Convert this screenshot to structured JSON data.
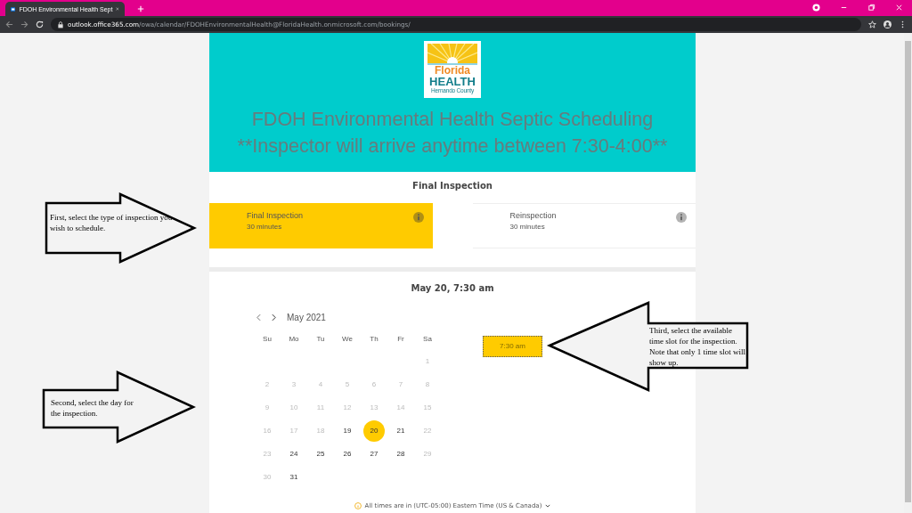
{
  "browser": {
    "tab": {
      "title": "FDOH Environmental Health Sept",
      "selected": true
    },
    "url": {
      "host": "outlook.office365.com",
      "path": "/owa/calendar/FDOHEnvironmentalHealth@FloridaHealth.onmicrosoft.com/bookings/"
    }
  },
  "header": {
    "logo": {
      "line_1": "Florida",
      "line_2": "HEALTH",
      "line_3": "Hernando County"
    },
    "title": "FDOH Environmental Health Septic Scheduling",
    "subtitle": "**Inspector will arrive anytime between 7:30-4:00**"
  },
  "services": {
    "heading": "Final Inspection",
    "items": [
      {
        "name": "Final Inspection",
        "duration": "30 minutes",
        "selected": true
      },
      {
        "name": "Reinspection",
        "duration": "30 minutes",
        "selected": false
      }
    ]
  },
  "booking": {
    "heading": "May 20, 7:30 am",
    "month": "May 2021",
    "weekdays": [
      "Su",
      "Mo",
      "Tu",
      "We",
      "Th",
      "Fr",
      "Sa"
    ],
    "weeks": [
      {
        "days": [
          {
            "kind": "blank"
          },
          {
            "kind": "blank"
          },
          {
            "kind": "blank"
          },
          {
            "kind": "blank"
          },
          {
            "kind": "blank"
          },
          {
            "kind": "blank"
          },
          {
            "kind": "day",
            "label": "1",
            "available": false,
            "selected": false
          }
        ]
      },
      {
        "days": [
          {
            "label": "2",
            "available": false,
            "selected": false
          },
          {
            "label": "3",
            "available": false,
            "selected": false
          },
          {
            "label": "4",
            "available": false,
            "selected": false
          },
          {
            "label": "5",
            "available": false,
            "selected": false
          },
          {
            "label": "6",
            "available": false,
            "selected": false
          },
          {
            "label": "7",
            "available": false,
            "selected": false
          },
          {
            "label": "8",
            "available": false,
            "selected": false
          }
        ]
      },
      {
        "days": [
          {
            "label": "9",
            "available": false,
            "selected": false
          },
          {
            "label": "10",
            "available": false,
            "selected": false
          },
          {
            "label": "11",
            "available": false,
            "selected": false
          },
          {
            "label": "12",
            "available": false,
            "selected": false
          },
          {
            "label": "13",
            "available": false,
            "selected": false
          },
          {
            "label": "14",
            "available": false,
            "selected": false
          },
          {
            "label": "15",
            "available": false,
            "selected": false
          }
        ]
      },
      {
        "days": [
          {
            "label": "16",
            "available": false,
            "selected": false
          },
          {
            "label": "17",
            "available": false,
            "selected": false
          },
          {
            "label": "18",
            "available": false,
            "selected": false
          },
          {
            "label": "19",
            "available": true,
            "selected": false
          },
          {
            "label": "20",
            "available": true,
            "selected": true
          },
          {
            "label": "21",
            "available": true,
            "selected": false
          },
          {
            "label": "22",
            "available": false,
            "selected": false
          }
        ]
      },
      {
        "days": [
          {
            "label": "23",
            "available": false,
            "selected": false
          },
          {
            "label": "24",
            "available": true,
            "selected": false
          },
          {
            "label": "25",
            "available": true,
            "selected": false
          },
          {
            "label": "26",
            "available": true,
            "selected": false
          },
          {
            "label": "27",
            "available": true,
            "selected": false
          },
          {
            "label": "28",
            "available": true,
            "selected": false
          },
          {
            "label": "29",
            "available": false,
            "selected": false
          }
        ]
      },
      {
        "days": [
          {
            "label": "30",
            "available": false,
            "selected": false
          },
          {
            "label": "31",
            "available": true,
            "selected": false
          }
        ]
      }
    ],
    "time_slots": [
      {
        "label": "7:30 am",
        "selected": true
      }
    ],
    "timezone_note": "All times are in  (UTC-05:00) Eastern Time (US & Canada)"
  },
  "callouts": [
    {
      "text": "First, select the type of inspection you wish to schedule.",
      "kind": "right"
    },
    {
      "text": "Second, select the day for the inspection.",
      "kind": "right"
    },
    {
      "text": "Third, select the available time slot for the inspection. Note that only 1 time slot will show up.",
      "kind": "left"
    }
  ]
}
